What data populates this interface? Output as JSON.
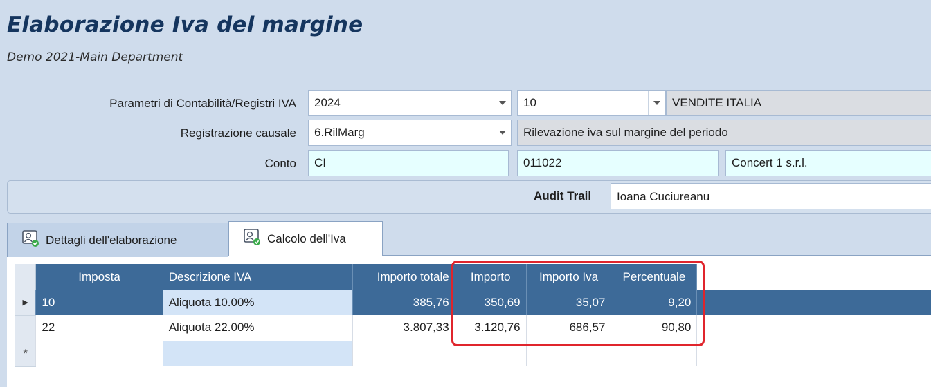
{
  "header": {
    "title": "Elaborazione Iva del margine",
    "subtitle": "Demo 2021-Main Department"
  },
  "form": {
    "parametri_label": "Parametri di Contabilità/Registri IVA",
    "parametri_year": "2024",
    "parametri_register": "10",
    "parametri_register_desc": "VENDITE ITALIA",
    "registrazione_label": "Registrazione causale",
    "registrazione_code": "6.RilMarg",
    "registrazione_desc": "Rilevazione iva sul margine del periodo",
    "conto_label": "Conto",
    "conto_type": "CI",
    "conto_code": "011022",
    "conto_name": "Concert 1 s.r.l.",
    "audit_label": "Audit Trail",
    "audit_value": "Ioana Cuciureanu"
  },
  "tabs": [
    {
      "label": "Dettagli dell'elaborazione",
      "icon": "user-badge-icon",
      "active": false
    },
    {
      "label": "Calcolo dell'Iva",
      "icon": "user-badge-icon",
      "active": true
    }
  ],
  "grid": {
    "columns": [
      "Imposta",
      "Descrizione IVA",
      "Importo totale",
      "Importo",
      "Importo Iva",
      "Percentuale"
    ],
    "rows": [
      {
        "imposta": "10",
        "descrizione": "Aliquota 10.00%",
        "importo_totale": "385,76",
        "importo": "350,69",
        "importo_iva": "35,07",
        "percentuale": "9,20"
      },
      {
        "imposta": "22",
        "descrizione": "Aliquota 22.00%",
        "importo_totale": "3.807,33",
        "importo": "3.120,76",
        "importo_iva": "686,57",
        "percentuale": "90,80"
      }
    ],
    "new_row_marker": "*"
  },
  "colors": {
    "header_blue": "#3d6a98",
    "highlight_red": "#e0252c",
    "title_navy": "#15355e"
  }
}
